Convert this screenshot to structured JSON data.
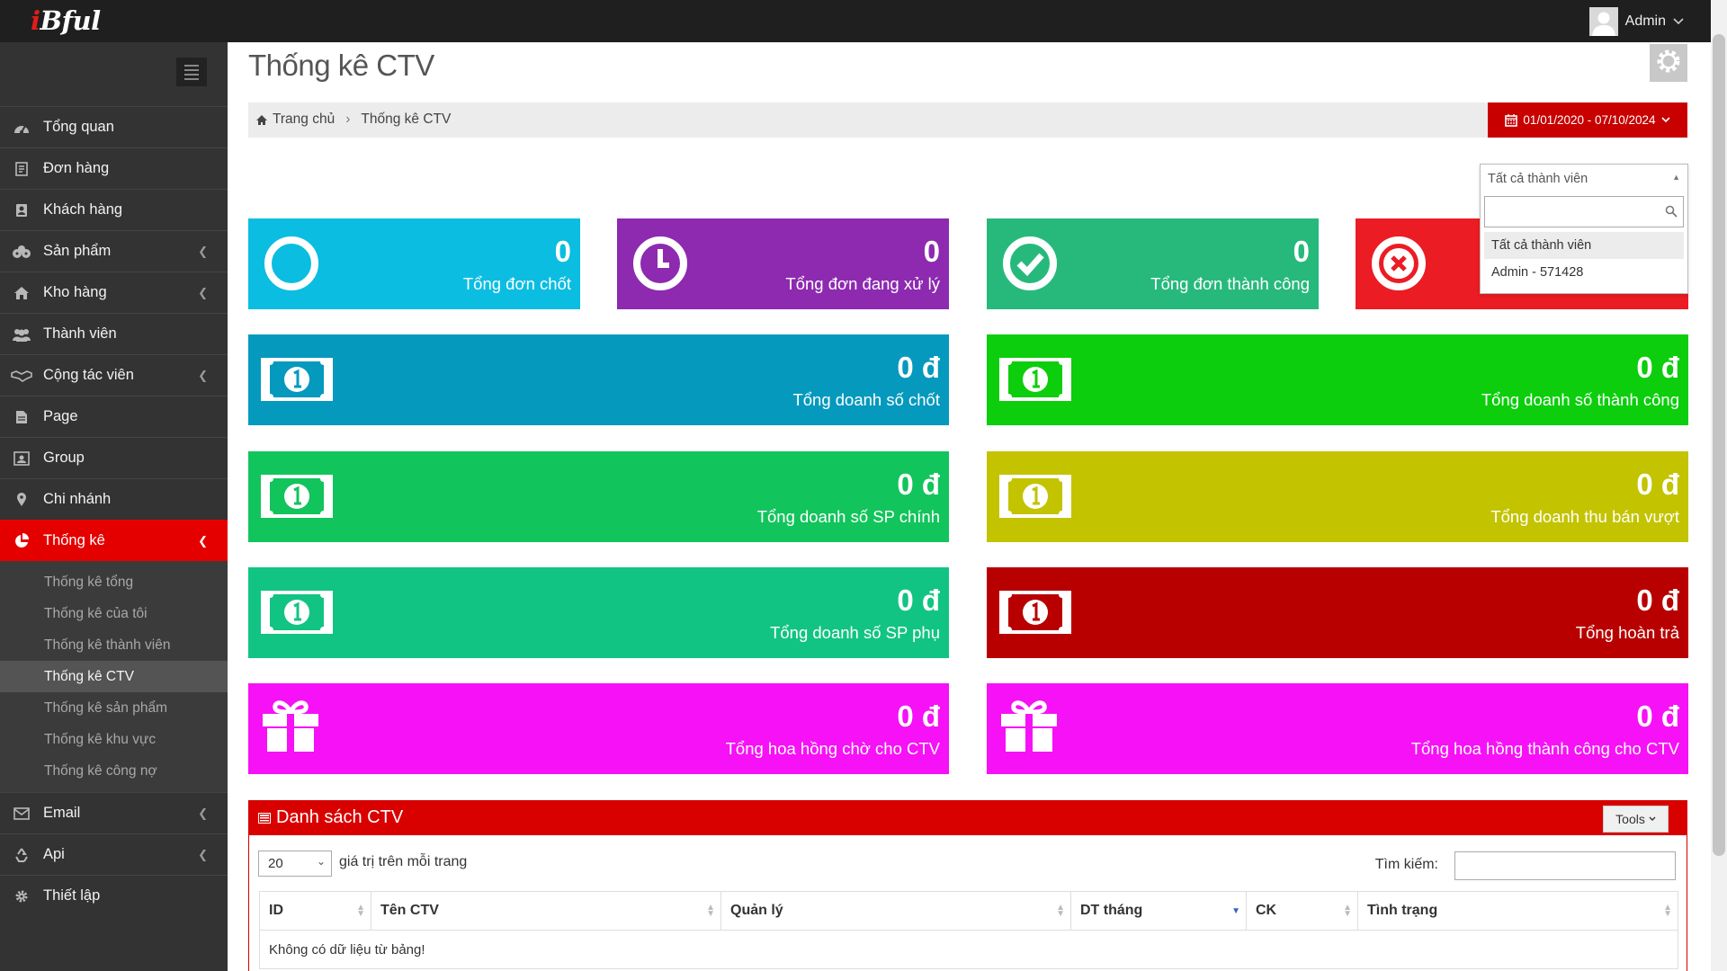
{
  "app": {
    "logo_i": "i",
    "logo_rest": "Bful",
    "user_name": "Admin"
  },
  "sidebar": {
    "items": [
      {
        "label": "Tổng quan",
        "icon": "dashboard-icon"
      },
      {
        "label": "Đơn hàng",
        "icon": "orders-icon"
      },
      {
        "label": "Khách hàng",
        "icon": "customer-icon"
      },
      {
        "label": "Sản phẩm",
        "icon": "products-icon"
      },
      {
        "label": "Kho hàng",
        "icon": "warehouse-icon"
      },
      {
        "label": "Thành viên",
        "icon": "members-icon"
      },
      {
        "label": "Cộng tác viên",
        "icon": "handshake-icon"
      },
      {
        "label": "Page",
        "icon": "page-icon"
      },
      {
        "label": "Group",
        "icon": "group-icon"
      },
      {
        "label": "Chi nhánh",
        "icon": "map-marker-icon"
      },
      {
        "label": "Thống kê",
        "icon": "pie-chart-icon"
      },
      {
        "label": "Email",
        "icon": "email-icon"
      },
      {
        "label": "Api",
        "icon": "recycle-icon"
      },
      {
        "label": "Thiết lập",
        "icon": "gear-icon"
      }
    ],
    "stats_sub": [
      "Thống kê tổng",
      "Thống kê của tôi",
      "Thống kê thành viên",
      "Thống kê CTV",
      "Thống kê sản phẩm",
      "Thống kê khu vực",
      "Thống kê công nợ"
    ]
  },
  "page": {
    "title": "Thống kê CTV",
    "breadcrumb_home": "Trang chủ",
    "breadcrumb_current": "Thống kê CTV",
    "date_range": "01/01/2020 - 07/10/2024"
  },
  "member_filter": {
    "selected": "Tất cả thành viên",
    "search_value": "",
    "options": [
      "Tất cả thành viên",
      "Admin - 571428"
    ]
  },
  "tiles": {
    "orders_closed": {
      "value": "0",
      "label": "Tổng đơn chốt"
    },
    "orders_processing": {
      "value": "0",
      "label": "Tổng đơn đang xử lý"
    },
    "orders_success": {
      "value": "0",
      "label": "Tổng đơn thành công"
    },
    "revenue_closed": {
      "value": "0 đ",
      "label": "Tổng doanh số chốt"
    },
    "revenue_success": {
      "value": "0 đ",
      "label": "Tổng doanh số thành công"
    },
    "revenue_main": {
      "value": "0 đ",
      "label": "Tổng doanh số SP chính"
    },
    "revenue_over": {
      "value": "0 đ",
      "label": "Tổng doanh thu bán vượt"
    },
    "revenue_sub": {
      "value": "0 đ",
      "label": "Tổng doanh số SP phụ"
    },
    "refund": {
      "value": "0 đ",
      "label": "Tổng hoàn trả"
    },
    "comm_pending": {
      "value": "0 đ",
      "label": "Tổng hoa hồng chờ cho CTV"
    },
    "comm_success": {
      "value": "0 đ",
      "label": "Tổng hoa hồng thành công cho CTV"
    }
  },
  "colors": {
    "accent_red": "#e50000",
    "tile_cyan": "#0bbde1",
    "tile_purple": "#8d2ab0",
    "tile_teal_green": "#27b97c",
    "tile_red": "#ec1c24",
    "tile_dark_cyan": "#0599bd",
    "tile_lime": "#0cce0c",
    "tile_green": "#12c45c",
    "tile_olive": "#c3c300",
    "tile_teal": "#12c483",
    "tile_dark_red": "#b80000",
    "tile_magenta": "#f611f6"
  },
  "table": {
    "title": "Danh sách CTV",
    "tools_label": "Tools",
    "page_size": "20",
    "page_size_label": "giá trị trên mỗi trang",
    "search_label": "Tìm kiếm:",
    "search_value": "",
    "columns": [
      "ID",
      "Tên CTV",
      "Quản lý",
      "DT tháng",
      "CK",
      "Tình trạng"
    ],
    "empty_text": "Không có dữ liệu từ bảng!"
  }
}
